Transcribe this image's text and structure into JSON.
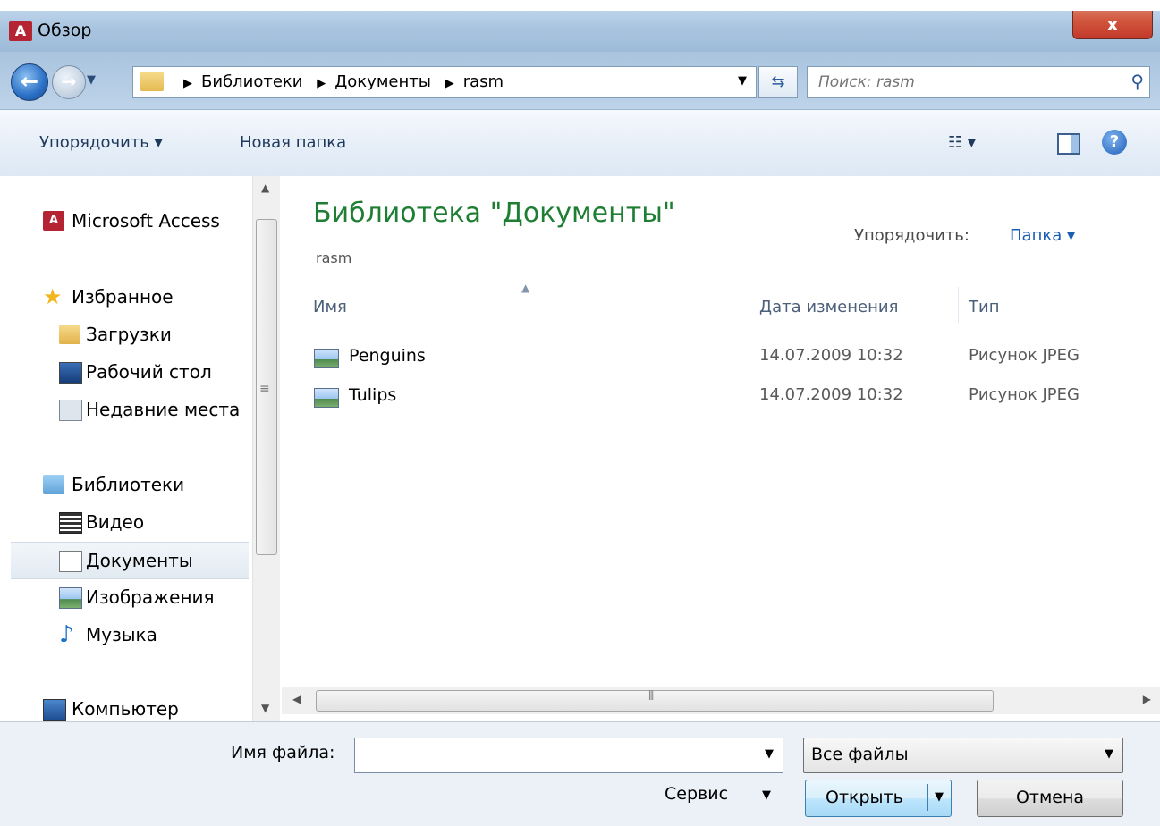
{
  "window": {
    "title": "Обзор",
    "app_icon": "access-icon",
    "close_label": "x"
  },
  "address": {
    "crumbs": [
      "Библиотеки",
      "Документы",
      "rasm"
    ],
    "search_placeholder": "Поиск: rasm"
  },
  "toolbar": {
    "organize_label": "Упорядочить ▾",
    "new_folder_label": "Новая папка"
  },
  "nav": {
    "items": [
      {
        "label": "Microsoft Access",
        "icon": "access-icon"
      },
      {
        "label": "Избранное",
        "icon": "star-icon"
      },
      {
        "label": "Загрузки",
        "icon": "downloads-folder-icon"
      },
      {
        "label": "Рабочий стол",
        "icon": "desktop-icon"
      },
      {
        "label": "Недавние места",
        "icon": "recent-places-icon"
      },
      {
        "label": "Библиотеки",
        "icon": "libraries-icon"
      },
      {
        "label": "Видео",
        "icon": "video-icon"
      },
      {
        "label": "Документы",
        "icon": "documents-icon",
        "selected": true
      },
      {
        "label": "Изображения",
        "icon": "pictures-icon"
      },
      {
        "label": "Музыка",
        "icon": "music-icon"
      },
      {
        "label": "Компьютер",
        "icon": "computer-icon"
      }
    ]
  },
  "main": {
    "library_title": "Библиотека \"Документы\"",
    "library_subtitle": "rasm",
    "arrange_label": "Упорядочить:",
    "arrange_value": "Папка ▾",
    "columns": [
      "Имя",
      "Дата изменения",
      "Тип"
    ],
    "files": [
      {
        "name": "Penguins",
        "date": "14.07.2009 10:32",
        "type": "Рисунок JPEG"
      },
      {
        "name": "Tulips",
        "date": "14.07.2009 10:32",
        "type": "Рисунок JPEG"
      }
    ]
  },
  "bottom": {
    "filename_label": "Имя файла:",
    "filename_value": "",
    "filetype_value": "Все файлы",
    "service_label": "Сервис",
    "open_label": "Открыть",
    "cancel_label": "Отмена"
  },
  "colors": {
    "library_title": "#1e7e34",
    "arrange_value": "#1a5fb4",
    "close_button": "#c2392a"
  }
}
